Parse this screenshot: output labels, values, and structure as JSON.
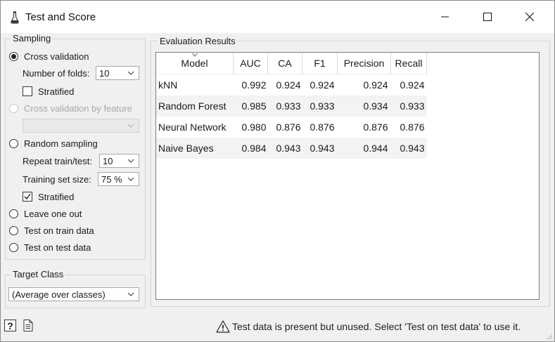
{
  "window": {
    "title": "Test and Score"
  },
  "sampling": {
    "title": "Sampling",
    "cross_validation": "Cross validation",
    "folds_label": "Number of folds:",
    "folds_value": "10",
    "stratified_cv": "Stratified",
    "cv_by_feature": "Cross validation by feature",
    "random_sampling": "Random sampling",
    "repeat_label": "Repeat train/test:",
    "repeat_value": "10",
    "train_size_label": "Training set size:",
    "train_size_value": "75 %",
    "stratified_rs": "Stratified",
    "leave_one_out": "Leave one out",
    "test_on_train": "Test on train data",
    "test_on_test": "Test on test data"
  },
  "target": {
    "title": "Target Class",
    "value": "(Average over classes)"
  },
  "results": {
    "title": "Evaluation Results",
    "columns": [
      "Model",
      "AUC",
      "CA",
      "F1",
      "Precision",
      "Recall"
    ],
    "rows": [
      [
        "kNN",
        "0.992",
        "0.924",
        "0.924",
        "0.924",
        "0.924"
      ],
      [
        "Random Forest",
        "0.985",
        "0.933",
        "0.933",
        "0.934",
        "0.933"
      ],
      [
        "Neural Network",
        "0.980",
        "0.876",
        "0.876",
        "0.876",
        "0.876"
      ],
      [
        "Naive Bayes",
        "0.984",
        "0.943",
        "0.943",
        "0.944",
        "0.943"
      ]
    ]
  },
  "status": {
    "help_label": "?",
    "message": "Test data is present but unused. Select 'Test on test data' to use it."
  },
  "icons": {
    "app": "flask-icon",
    "warning": "warning-triangle-icon",
    "report": "document-icon",
    "help": "help-icon"
  },
  "colors": {
    "window_bg": "#f0f0f0",
    "table_alt_row": "#f3f3f3"
  }
}
